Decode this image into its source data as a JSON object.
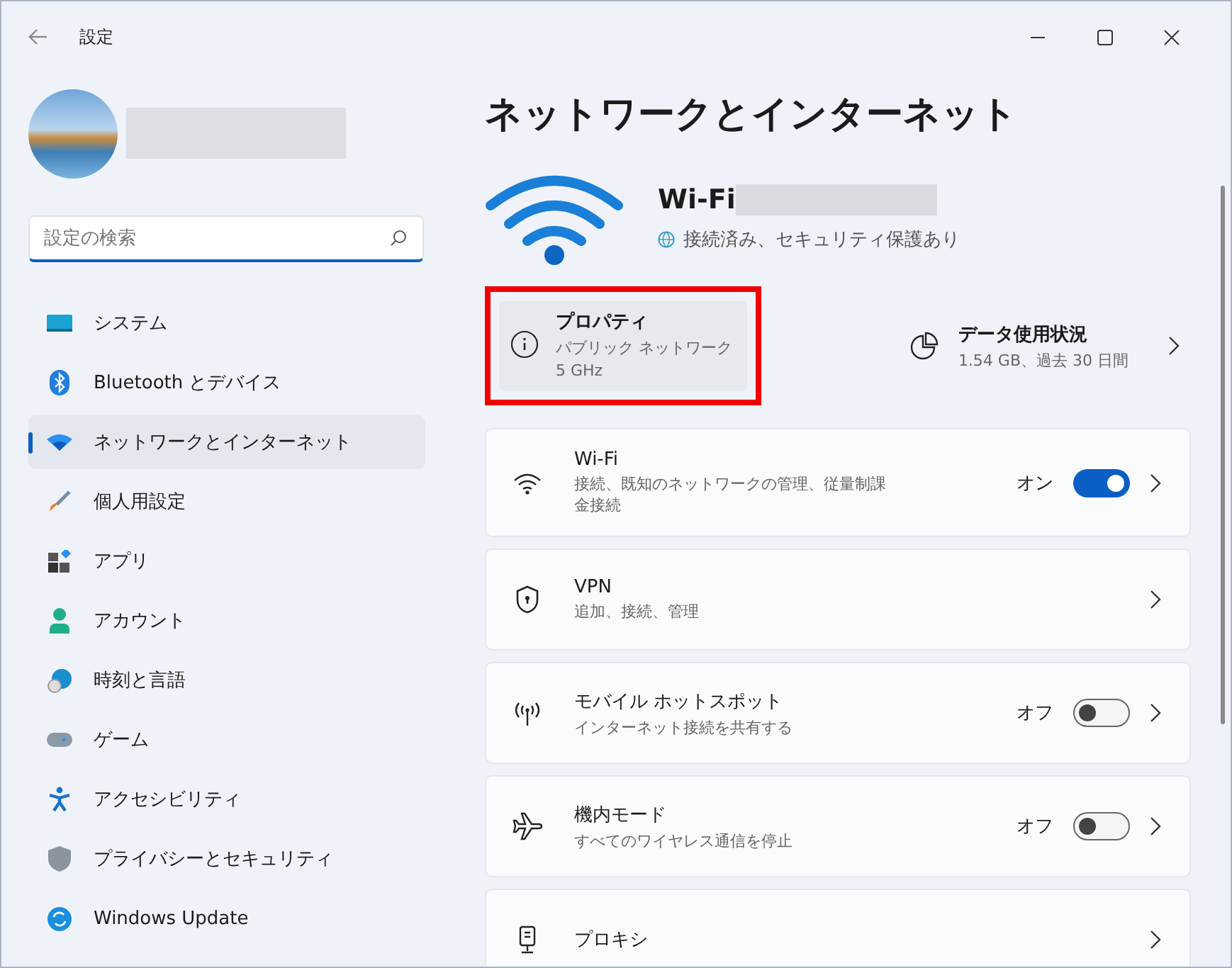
{
  "window": {
    "title": "設定"
  },
  "sidebar": {
    "search": {
      "placeholder": "設定の検索"
    },
    "items": [
      {
        "label": "システム",
        "selected": false
      },
      {
        "label": "Bluetooth とデバイス",
        "selected": false
      },
      {
        "label": "ネットワークとインターネット",
        "selected": true
      },
      {
        "label": "個人用設定",
        "selected": false
      },
      {
        "label": "アプリ",
        "selected": false
      },
      {
        "label": "アカウント",
        "selected": false
      },
      {
        "label": "時刻と言語",
        "selected": false
      },
      {
        "label": "ゲーム",
        "selected": false
      },
      {
        "label": "アクセシビリティ",
        "selected": false
      },
      {
        "label": "プライバシーとセキュリティ",
        "selected": false
      },
      {
        "label": "Windows Update",
        "selected": false
      }
    ]
  },
  "page": {
    "title": "ネットワークとインターネット",
    "network": {
      "name": "Wi-Fi",
      "status": "接続済み、セキュリティ保護あり"
    },
    "properties": {
      "title": "プロパティ",
      "lines": [
        "パブリック ネットワーク",
        "5 GHz"
      ]
    },
    "data_usage": {
      "title": "データ使用状況",
      "detail": "1.54 GB、過去 30 日間"
    },
    "cards": [
      {
        "kind": "toggle",
        "title": "Wi-Fi",
        "description": "接続、既知のネットワークの管理、従量制課金接続",
        "on": true,
        "state_label": "オン"
      },
      {
        "kind": "link",
        "title": "VPN",
        "description": "追加、接続、管理"
      },
      {
        "kind": "toggle",
        "title": "モバイル ホットスポット",
        "description": "インターネット接続を共有する",
        "on": false,
        "state_label": "オフ"
      },
      {
        "kind": "toggle",
        "title": "機内モード",
        "description": "すべてのワイヤレス通信を停止",
        "on": false,
        "state_label": "オフ"
      },
      {
        "kind": "link",
        "title": "プロキシ"
      }
    ]
  }
}
